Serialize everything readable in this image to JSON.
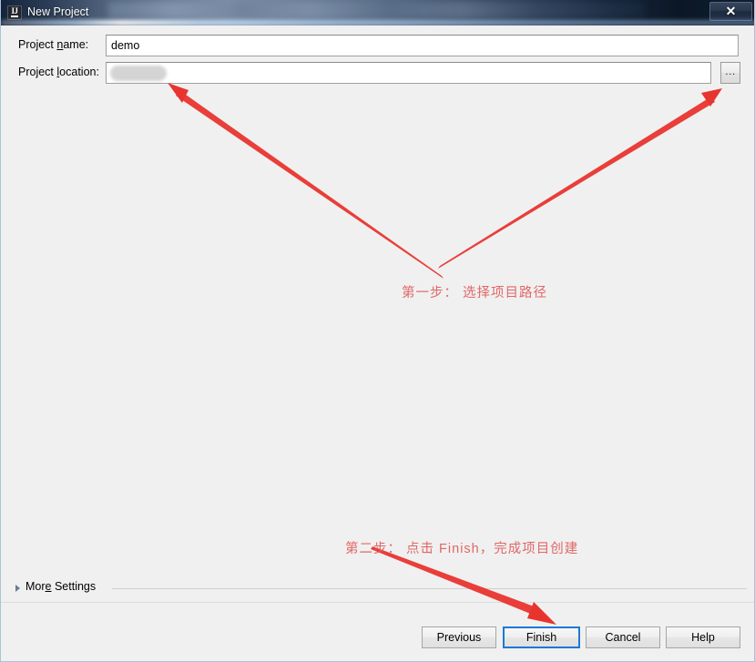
{
  "window": {
    "title": "New Project",
    "app_icon": "intellij-idea-icon",
    "close_label": "✕",
    "titlebar_blur_note": "blurred-path-text"
  },
  "form": {
    "fields": [
      {
        "label_prefix": "Project ",
        "label_mnemonic": "n",
        "label_suffix": "ame:",
        "value": "demo",
        "placeholder": ""
      },
      {
        "label_prefix": "Project ",
        "label_mnemonic": "l",
        "label_suffix": "ocation:",
        "value": "",
        "placeholder": ""
      }
    ],
    "browse_label": "…"
  },
  "more_settings": {
    "label_prefix": "Mor",
    "label_mnemonic": "e",
    "label_suffix": " Settings",
    "expanded": false,
    "arrow_icon": "chevron-right-icon"
  },
  "footer": {
    "buttons": [
      {
        "label": "Previous",
        "focused": false
      },
      {
        "label": "Finish",
        "focused": true
      },
      {
        "label": "Cancel",
        "focused": false
      },
      {
        "label": "Help",
        "focused": false
      }
    ]
  },
  "annotations": {
    "step1": "第一步： 选择项目路径",
    "step2": "第二步： 点击 Finish，完成项目创建",
    "color": "#e05b5b",
    "arrow_color": "#e8342e"
  },
  "colors": {
    "dialog_background": "#f0f0f0",
    "titlebar_dark": "#13233a",
    "focus_blue": "#1e78d7",
    "annotation_red": "#e8342e",
    "window_border": "#a8c4dc"
  }
}
